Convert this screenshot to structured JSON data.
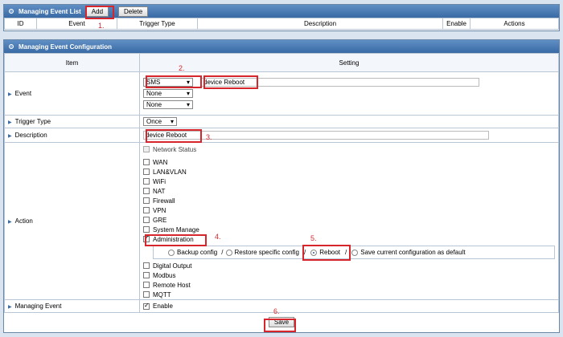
{
  "list_panel": {
    "title": "Managing Event List",
    "add_label": "Add",
    "delete_label": "Delete",
    "columns": [
      "ID",
      "Event",
      "Trigger Type",
      "Description",
      "Enable",
      "Actions"
    ]
  },
  "config_panel": {
    "title": "Managing Event Configuration",
    "col_item": "Item",
    "col_setting": "Setting",
    "event": {
      "label": "Event",
      "select1": "SMS",
      "text_value": "device Reboot",
      "select2": "None",
      "select3": "None"
    },
    "trigger": {
      "label": "Trigger Type",
      "value": "Once"
    },
    "description": {
      "label": "Description",
      "value": "device Reboot"
    },
    "action": {
      "label": "Action",
      "network_status": "Network Status",
      "items": [
        "WAN",
        "LAN&VLAN",
        "WiFi",
        "NAT",
        "Firewall",
        "VPN",
        "GRE",
        "System Manage"
      ],
      "administration": "Administration",
      "admin_options": {
        "backup": "Backup config",
        "restore": "Restore specific config",
        "reboot": "Reboot",
        "save_default": "Save current configuration as default",
        "sep": "/"
      },
      "items_after": [
        "Digital Output",
        "Modbus",
        "Remote Host",
        "MQTT"
      ]
    },
    "managing_event": {
      "label": "Managing Event",
      "enable": "Enable"
    },
    "save_label": "Save"
  },
  "annotations": [
    "1.",
    "2.",
    "3.",
    "4.",
    "5.",
    "6."
  ],
  "colors": {
    "header": "#3a6aa4",
    "annotation": "#d6262c"
  }
}
